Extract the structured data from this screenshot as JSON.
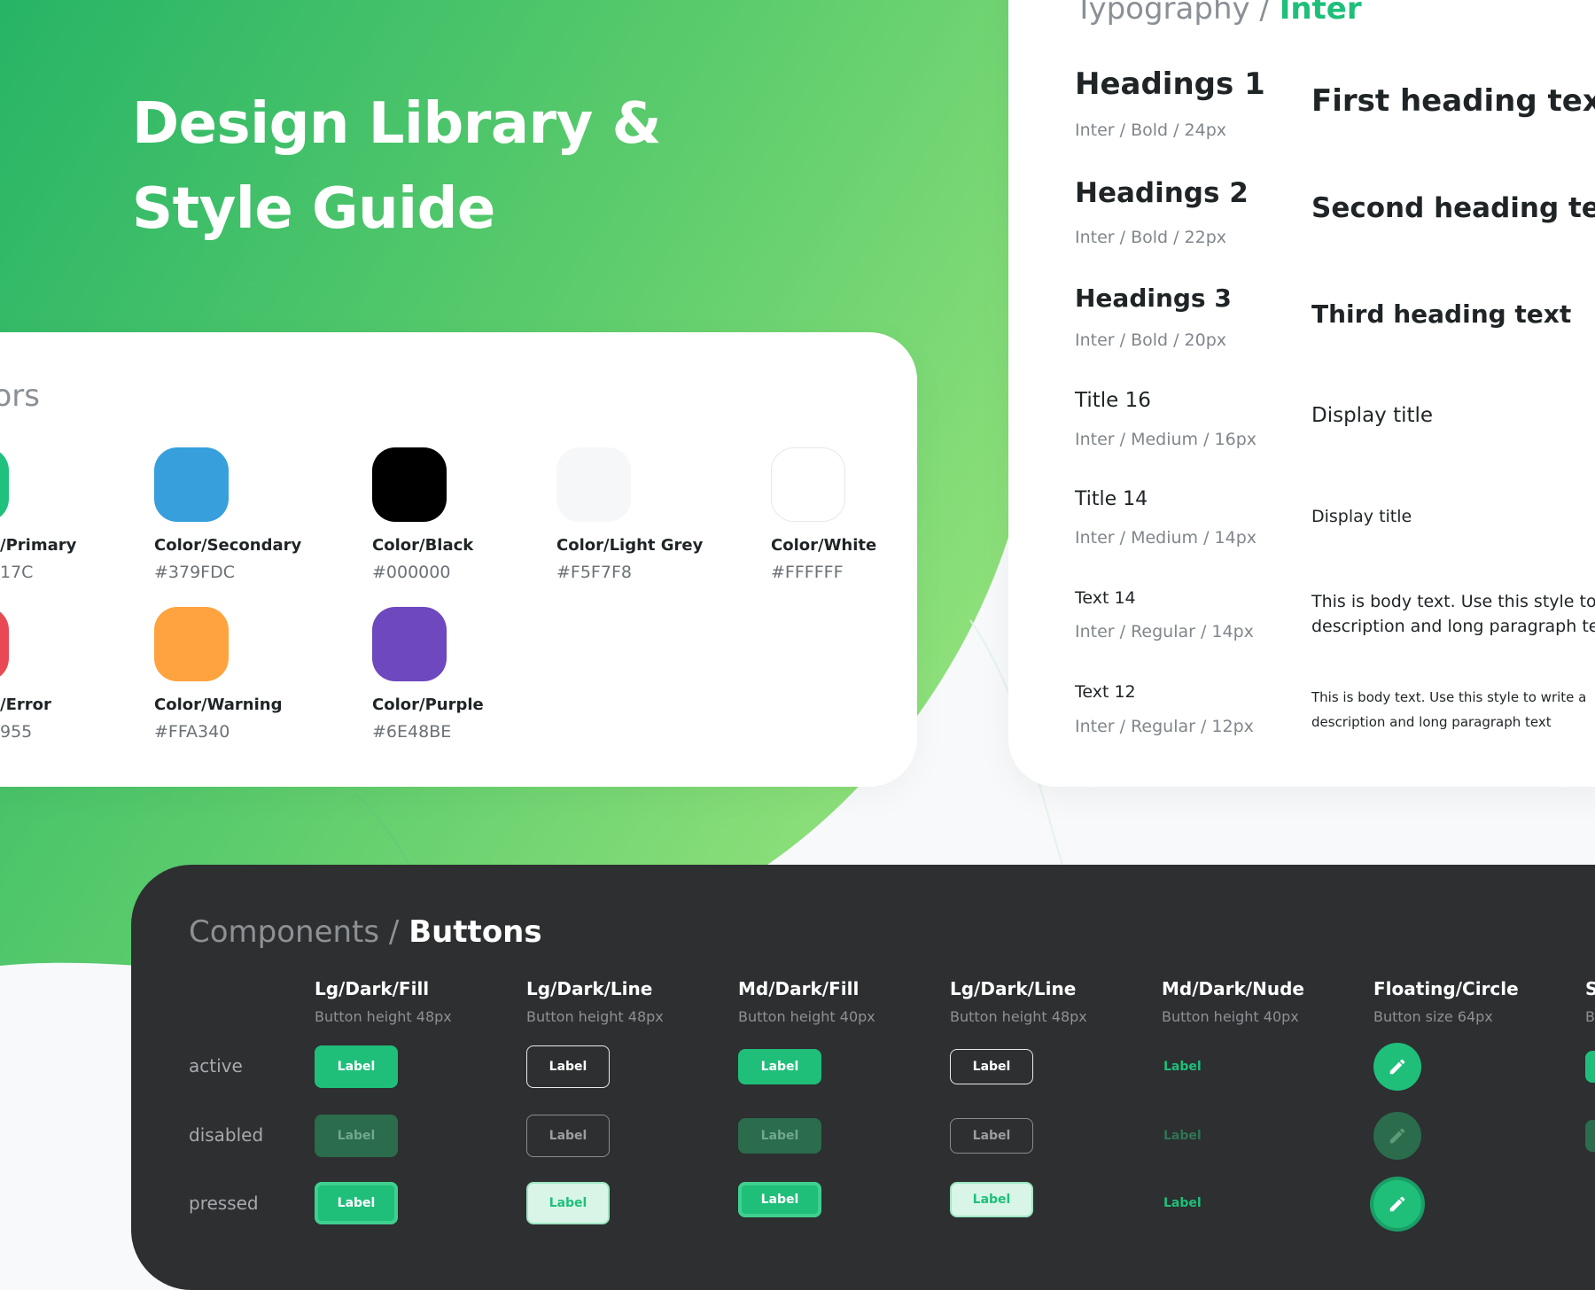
{
  "hero": {
    "title": "Design Library & Style Guide"
  },
  "colors": {
    "heading": "lors",
    "swatches": [
      {
        "name": "/Primary",
        "hex": "17C",
        "color": "#1FC17C"
      },
      {
        "name": "Color/Secondary",
        "hex": "#379FDC",
        "color": "#379FDC"
      },
      {
        "name": "Color/Black",
        "hex": "#000000",
        "color": "#000000"
      },
      {
        "name": "Color/Light Grey",
        "hex": "#F5F7F8",
        "color": "#F5F7F8"
      },
      {
        "name": "Color/White",
        "hex": "#FFFFFF",
        "color": "#FFFFFF"
      },
      {
        "name": "/Error",
        "hex": "955",
        "color": "#E84955"
      },
      {
        "name": "Color/Warning",
        "hex": "#FFA340",
        "color": "#FFA340"
      },
      {
        "name": "Color/Purple",
        "hex": "#6E48BE",
        "color": "#6E48BE"
      }
    ]
  },
  "typography": {
    "heading_prefix": "Typography /",
    "heading_accent": "Inter",
    "styles": [
      {
        "name": "Headings 1",
        "spec": "Inter / Bold / 24px",
        "sample": "First heading text"
      },
      {
        "name": "Headings 2",
        "spec": "Inter / Bold / 22px",
        "sample": "Second heading text"
      },
      {
        "name": "Headings 3",
        "spec": "Inter / Bold / 20px",
        "sample": "Third heading text"
      },
      {
        "name": "Title 16",
        "spec": "Inter / Medium / 16px",
        "sample": "Display title"
      },
      {
        "name": "Title 14",
        "spec": "Inter / Medium / 14px",
        "sample": "Display title"
      },
      {
        "name": "Text 14",
        "spec": "Inter / Regular / 14px",
        "sample_line1": "This is body text. Use this style to",
        "sample_line2": "description and long paragraph te"
      },
      {
        "name": "Text 12",
        "spec": "Inter / Regular / 12px",
        "sample_line1": "This is body text. Use this style to write a",
        "sample_line2": "description and long paragraph text"
      }
    ]
  },
  "components": {
    "heading_prefix": "Components /",
    "heading_strong": "Buttons",
    "states": [
      "active",
      "disabled",
      "pressed"
    ],
    "columns": [
      {
        "title": "Lg/Dark/Fill",
        "sub": "Button height 48px"
      },
      {
        "title": "Lg/Dark/Line",
        "sub": "Button height 48px"
      },
      {
        "title": "Md/Dark/Fill",
        "sub": "Button height 40px"
      },
      {
        "title": "Lg/Dark/Line",
        "sub": "Button height 48px"
      },
      {
        "title": "Md/Dark/Nude",
        "sub": "Button height 40px"
      },
      {
        "title": "Floating/Circle",
        "sub": "Button size 64px"
      },
      {
        "title": "S",
        "sub": "B"
      }
    ],
    "button_label": "Label",
    "fab_icon": "pencil-icon",
    "accent": "#1FBF7A"
  }
}
